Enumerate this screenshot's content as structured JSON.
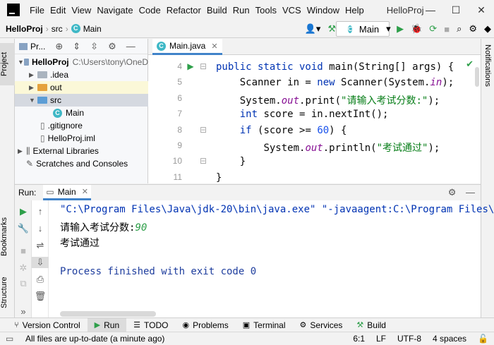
{
  "menubar": {
    "logo_icon": "intellij-logo-icon",
    "menus": [
      "File",
      "Edit",
      "View",
      "Navigate",
      "Code",
      "Refactor",
      "Build",
      "Run",
      "Tools",
      "VCS",
      "Window",
      "Help"
    ],
    "title": "HelloProj",
    "window_buttons": [
      "—",
      "☐",
      "✕"
    ]
  },
  "navbar": {
    "breadcrumbs": [
      "HelloProj",
      "src",
      "Main"
    ],
    "run_config": "Main"
  },
  "left_strip": {
    "project_tab": "Project",
    "bookmarks_tab": "Bookmarks",
    "structure_tab": "Structure"
  },
  "right_strip": {
    "notifications_tab": "Notifications"
  },
  "project_panel": {
    "header": "Pr...",
    "tree": [
      {
        "label": "HelloProj",
        "path": "C:\\Users\\tony\\OneD"
      },
      {
        "label": ".idea"
      },
      {
        "label": "out"
      },
      {
        "label": "src"
      },
      {
        "label": "Main"
      },
      {
        "label": ".gitignore"
      },
      {
        "label": "HelloProj.iml"
      },
      {
        "label": "External Libraries"
      },
      {
        "label": "Scratches and Consoles"
      }
    ]
  },
  "editor": {
    "tab": "Main.java",
    "line_numbers": [
      "4",
      "5",
      "6",
      "7",
      "8",
      "9",
      "10",
      "11"
    ],
    "lines": [
      {
        "indent": "",
        "parts": [
          [
            "kw",
            "public static void "
          ],
          [
            "",
            "main(String[] args) {"
          ]
        ]
      },
      {
        "indent": "    ",
        "parts": [
          [
            "",
            "Scanner in = "
          ],
          [
            "kw",
            "new "
          ],
          [
            "",
            "Scanner(System."
          ],
          [
            "fld",
            "in"
          ],
          [
            "",
            ");"
          ]
        ]
      },
      {
        "indent": "    ",
        "parts": [
          [
            "",
            "System."
          ],
          [
            "fld",
            "out"
          ],
          [
            "",
            ".print("
          ],
          [
            "str",
            "\"请输入考试分数:\""
          ],
          [
            "",
            ");"
          ]
        ]
      },
      {
        "indent": "    ",
        "parts": [
          [
            "kw",
            "int "
          ],
          [
            "",
            "score = in.nextInt();"
          ]
        ]
      },
      {
        "indent": "    ",
        "parts": [
          [
            "kw",
            "if "
          ],
          [
            "",
            "(score >= "
          ],
          [
            "num",
            "60"
          ],
          [
            "",
            ") {"
          ]
        ]
      },
      {
        "indent": "        ",
        "parts": [
          [
            "",
            "System."
          ],
          [
            "fld",
            "out"
          ],
          [
            "",
            ".println("
          ],
          [
            "str",
            "\"考试通过\""
          ],
          [
            "",
            ");"
          ]
        ]
      },
      {
        "indent": "    ",
        "parts": [
          [
            "",
            "}"
          ]
        ]
      },
      {
        "indent": "",
        "parts": [
          [
            "",
            "}"
          ]
        ]
      }
    ]
  },
  "run_panel": {
    "label": "Run:",
    "tab": "Main",
    "console": {
      "command": "\"C:\\Program Files\\Java\\jdk-20\\bin\\java.exe\" \"-javaagent:C:\\Program Files\\J",
      "prompt": "请输入考试分数:",
      "input": "90",
      "output": "考试通过",
      "exit": "Process finished with exit code 0"
    }
  },
  "bottom_tabs": [
    "Version Control",
    "Run",
    "TODO",
    "Problems",
    "Terminal",
    "Services",
    "Build"
  ],
  "statusbar": {
    "message": "All files are up-to-date (a minute ago)",
    "position": "6:1",
    "line_sep": "LF",
    "encoding": "UTF-8",
    "indent": "4 spaces"
  },
  "colors": {
    "accent": "#4083c9",
    "run_green": "#2e9f4a",
    "keyword": "#0033b3",
    "string": "#067d17"
  }
}
